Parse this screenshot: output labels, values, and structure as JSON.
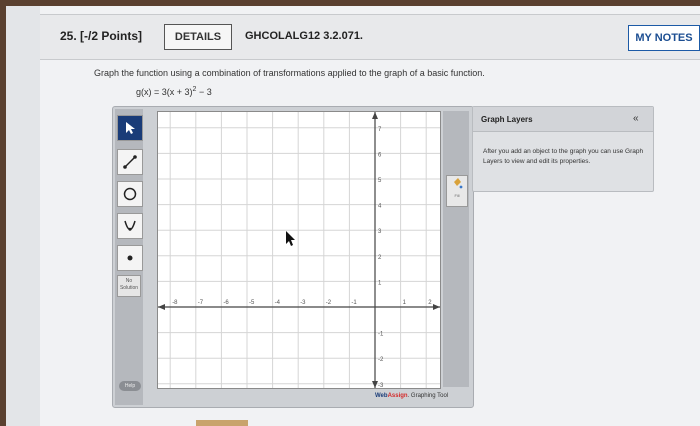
{
  "header": {
    "question_number": "25. [-/2 Points]",
    "details_label": "DETAILS",
    "question_code": "GHCOLALG12 3.2.071.",
    "my_notes_label": "MY NOTES"
  },
  "question": {
    "instruction": "Graph the function using a combination of transformations applied to the graph of a basic function.",
    "formula_left": "g(x) = 3(x + 3)",
    "formula_exp": "2",
    "formula_right": " − 3"
  },
  "tools": {
    "icons": [
      "pointer-arrow-icon",
      "line-segment-icon",
      "circle-icon",
      "parabola-icon",
      "point-icon"
    ],
    "no_solution_line1": "No",
    "no_solution_line2": "Solution",
    "help_label": "Help"
  },
  "graph": {
    "x_ticks": [
      "-8",
      "-7",
      "-6",
      "-5",
      "-4",
      "-3",
      "-2",
      "-1",
      "1",
      "2"
    ],
    "y_ticks": [
      "7",
      "6",
      "5",
      "4",
      "3",
      "2",
      "1",
      "-1",
      "-2",
      "-3"
    ],
    "fill_label": "Fill",
    "brand_web": "Web",
    "brand_assign": "Assign",
    "brand_suffix": ". Graphing Tool"
  },
  "layers": {
    "title": "Graph Layers",
    "collapse_symbol": "«",
    "help_text": "After you add an object to the graph you can use Graph Layers to view and edit its properties."
  },
  "colors": {
    "active_tool": "#1a3c78",
    "notes_border": "#1c5aa6",
    "brand_red": "#d42a2a"
  }
}
